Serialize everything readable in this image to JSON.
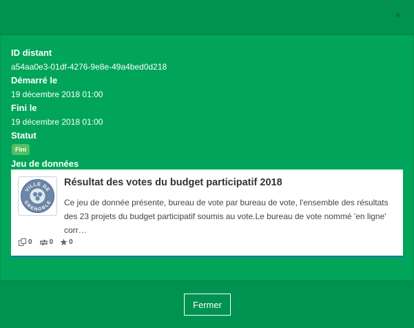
{
  "modal": {
    "close_glyph": "×"
  },
  "details": {
    "remote_id_label": "ID distant",
    "remote_id_value": "a54aa0e3-01df-4276-9e8e-49a4bed0d218",
    "started_label": "Démarré le",
    "started_value": "19 décembre 2018 01:00",
    "finished_label": "Fini le",
    "finished_value": "19 décembre 2018 01:00",
    "status_label": "Statut",
    "status_value": "Fini",
    "dataset_label": "Jeu de données"
  },
  "dataset": {
    "title": "Résultat des votes du budget participatif 2018",
    "description": "Ce jeu de donnée présente, bureau de vote par bureau de vote, l'ensemble des résultats des 23 projets du budget participatif soumis au vote.Le bureau de vote nommé 'en ligne' corr…",
    "logo_text_top": "VILLE DE",
    "logo_text_bottom": "GRENOBLE",
    "stats": {
      "reuses": "0",
      "followers": "0",
      "stars": "0"
    }
  },
  "footer": {
    "close_label": "Fermer"
  },
  "colors": {
    "modal_bg": "#00a55a",
    "header_bg": "#009250",
    "status_badge": "#54bf62",
    "card_accent": "#1f6fb5"
  }
}
